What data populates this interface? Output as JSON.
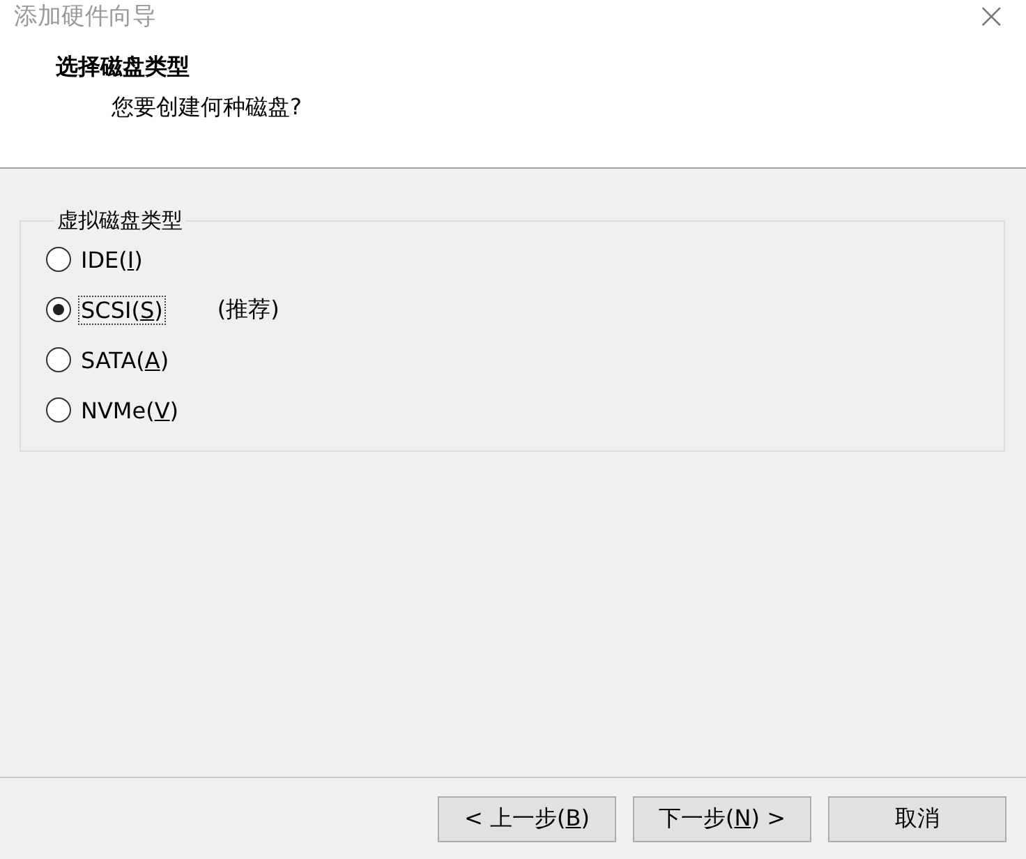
{
  "window": {
    "title": "添加硬件向导",
    "close": "×"
  },
  "header": {
    "title": "选择磁盘类型",
    "subtitle": "您要创建何种磁盘?"
  },
  "group": {
    "title": "虚拟磁盘类型",
    "options": [
      {
        "text_before": "IDE(",
        "access_key": "I",
        "text_after": ")",
        "selected": false
      },
      {
        "text_before": "SCSI(",
        "access_key": "S",
        "text_after": ")",
        "selected": true,
        "note": "(推荐)"
      },
      {
        "text_before": "SATA(",
        "access_key": "A",
        "text_after": ")",
        "selected": false
      },
      {
        "text_before": "NVMe(",
        "access_key": "V",
        "text_after": ")",
        "selected": false
      }
    ]
  },
  "buttons": [
    {
      "text_before": "< 上一步(",
      "access_key": "B",
      "text_after": ")",
      "disabled": false
    },
    {
      "text_before": "下一步(",
      "access_key": "N",
      "text_after": ") >",
      "disabled": false
    },
    {
      "text_before": "取消",
      "disabled": false
    }
  ]
}
